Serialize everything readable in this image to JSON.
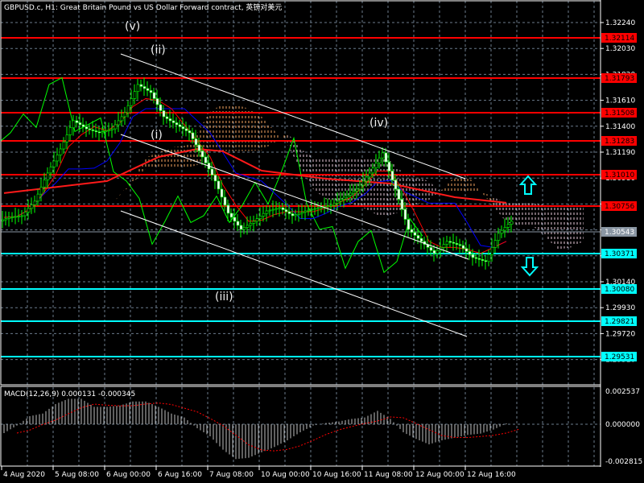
{
  "title": "GBPUSD.c, H1:  Great Britain Pound vs US Dollar Forward contract, 英镑对美元",
  "colors": {
    "background": "#000000",
    "grid": "#6b7b8c",
    "candle_bull": "#ffffff",
    "candle_wick": "#00ff00",
    "resistance": "#ff0000",
    "support": "#00ffff",
    "current": "#8a96a3",
    "tenkan": "#ff0000",
    "kijun": "#0000ff",
    "chikou": "#00ff00",
    "ma": "#ff1a1a",
    "cloud_up": "#f4a460",
    "cloud_down": "#e6c8d8",
    "channel": "#ffffff"
  },
  "price_axis": {
    "ticks": [
      "1.32240",
      "1.32030",
      "1.31820",
      "1.31610",
      "1.31400",
      "1.31190",
      "1.30980",
      "1.30770",
      "1.30560",
      "1.30350",
      "1.30140",
      "1.29930",
      "1.29720",
      "1.29510"
    ]
  },
  "levels": [
    {
      "price": "1.32114",
      "type": "resistance"
    },
    {
      "price": "1.31793",
      "type": "resistance"
    },
    {
      "price": "1.31508",
      "type": "resistance"
    },
    {
      "price": "1.31283",
      "type": "resistance"
    },
    {
      "price": "1.31010",
      "type": "resistance"
    },
    {
      "price": "1.30756",
      "type": "resistance"
    },
    {
      "price": "1.30543",
      "type": "current"
    },
    {
      "price": "1.30371",
      "type": "support"
    },
    {
      "price": "1.30080",
      "type": "support"
    },
    {
      "price": "1.29821",
      "type": "support"
    },
    {
      "price": "1.29531",
      "type": "support"
    }
  ],
  "wave_labels": [
    {
      "text": "(v)",
      "bar": 10,
      "price": 1.3218
    },
    {
      "text": "(ii)",
      "bar": 12,
      "price": 1.3199
    },
    {
      "text": "(i)",
      "bar": 12,
      "price": 1.313
    },
    {
      "text": "(iii)",
      "bar": 17,
      "price": 1.2999
    },
    {
      "text": "(iv)",
      "bar": 29,
      "price": 1.314
    }
  ],
  "signals": [
    {
      "type": "up-arrow",
      "icon": "arrow-up-icon"
    },
    {
      "type": "down-arrow",
      "icon": "arrow-down-icon"
    }
  ],
  "time_axis": {
    "labels": [
      "4 Aug 2020",
      "5 Aug 08:00",
      "6 Aug 00:00",
      "6 Aug 16:00",
      "7 Aug 08:00",
      "10 Aug 00:00",
      "10 Aug 16:00",
      "11 Aug 08:00",
      "12 Aug 00:00",
      "12 Aug 16:00"
    ]
  },
  "macd": {
    "label": "MACD(12,26,9) 0.000131 -0.000345",
    "axis": [
      "0.002537",
      "0.000000",
      "-0.002815"
    ],
    "histogram": [
      -0.00068,
      -0.0001,
      0.00062,
      0.00082,
      0.00155,
      0.00196,
      0.00196,
      0.00134,
      0.00134,
      0.00144,
      0.00175,
      0.00175,
      0.00134,
      0.00082,
      0.00052,
      -0.00031,
      -0.00093,
      -0.00196,
      -0.00268,
      -0.00258,
      -0.00216,
      -0.00175,
      -0.00124,
      -0.00062,
      -0.0001,
      0.0001,
      0.00021,
      0.00041,
      0.00052,
      0.00103,
      0.00041,
      -0.00062,
      -0.00113,
      -0.00155,
      -0.00124,
      -0.00103,
      -0.00082,
      -0.00072,
      -0.00041,
      6e-05
    ]
  },
  "chart_data": {
    "type": "candlestick",
    "symbol": "GBPUSD.c",
    "timeframe": "H1",
    "ylim": [
      1.294,
      1.3242
    ],
    "close": [
      1.30662,
      1.30675,
      1.30793,
      1.31021,
      1.31216,
      1.31445,
      1.31379,
      1.31347,
      1.31379,
      1.3151,
      1.31738,
      1.31673,
      1.31477,
      1.31412,
      1.31347,
      1.31151,
      1.30956,
      1.30695,
      1.30564,
      1.3063,
      1.30714,
      1.3074,
      1.30675,
      1.30714,
      1.3074,
      1.3076,
      1.30825,
      1.3089,
      1.31021,
      1.31184,
      1.3089,
      1.30564,
      1.30467,
      1.30369,
      1.30467,
      1.30434,
      1.30336,
      1.30304,
      1.30532,
      1.3063
    ],
    "ma": {
      "bars": [
        0,
        8,
        12,
        15,
        17,
        20,
        25,
        30,
        35,
        39
      ],
      "values": [
        1.30858,
        1.30956,
        1.31151,
        1.31216,
        1.31197,
        1.3104,
        1.30975,
        1.30936,
        1.30825,
        1.3078
      ]
    }
  }
}
